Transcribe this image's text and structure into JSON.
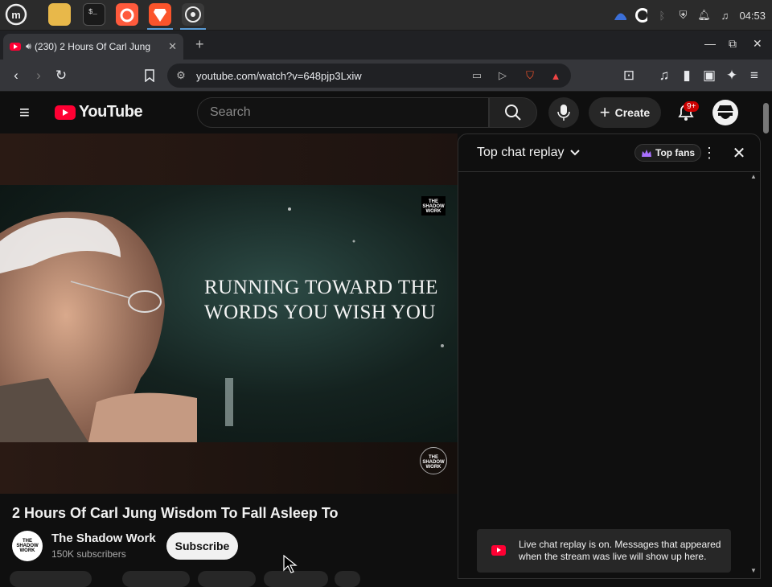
{
  "taskbar": {
    "clock": "04:53",
    "apps": [
      "mint-menu",
      "files",
      "terminal",
      "firefox",
      "brave",
      "obs"
    ],
    "tray_icons": [
      "vpn-icon",
      "obs-tray-icon",
      "bluetooth-icon",
      "shield-icon",
      "notification-icon",
      "music-icon"
    ]
  },
  "browser": {
    "tab_title": "(230) 2 Hours Of Carl Jung",
    "new_tab": "+",
    "url": "youtube.com/watch?v=648pjp3Lxiw"
  },
  "youtube": {
    "logo_text": "YouTube",
    "search_placeholder": "Search",
    "create_label": "Create",
    "notification_badge": "9+"
  },
  "video": {
    "overlay_line1": "RUNNING TOWARD THE",
    "overlay_line2": "WORDS YOU WISH YOU",
    "watermark": "THE SHADOW WORK",
    "title": "2 Hours Of Carl Jung Wisdom To Fall Asleep To",
    "channel_name": "The Shadow Work",
    "subscribers": "150K subscribers",
    "subscribe_label": "Subscribe",
    "channel_avatar_text": "THE SHADOW WORK"
  },
  "chat": {
    "title": "Top chat replay",
    "top_fans_label": "Top fans",
    "toast_text": "Live chat replay is on. Messages that appeared when the stream was live will show up here."
  },
  "colors": {
    "accent_red": "#ff0033",
    "background": "#0f0f0f"
  }
}
